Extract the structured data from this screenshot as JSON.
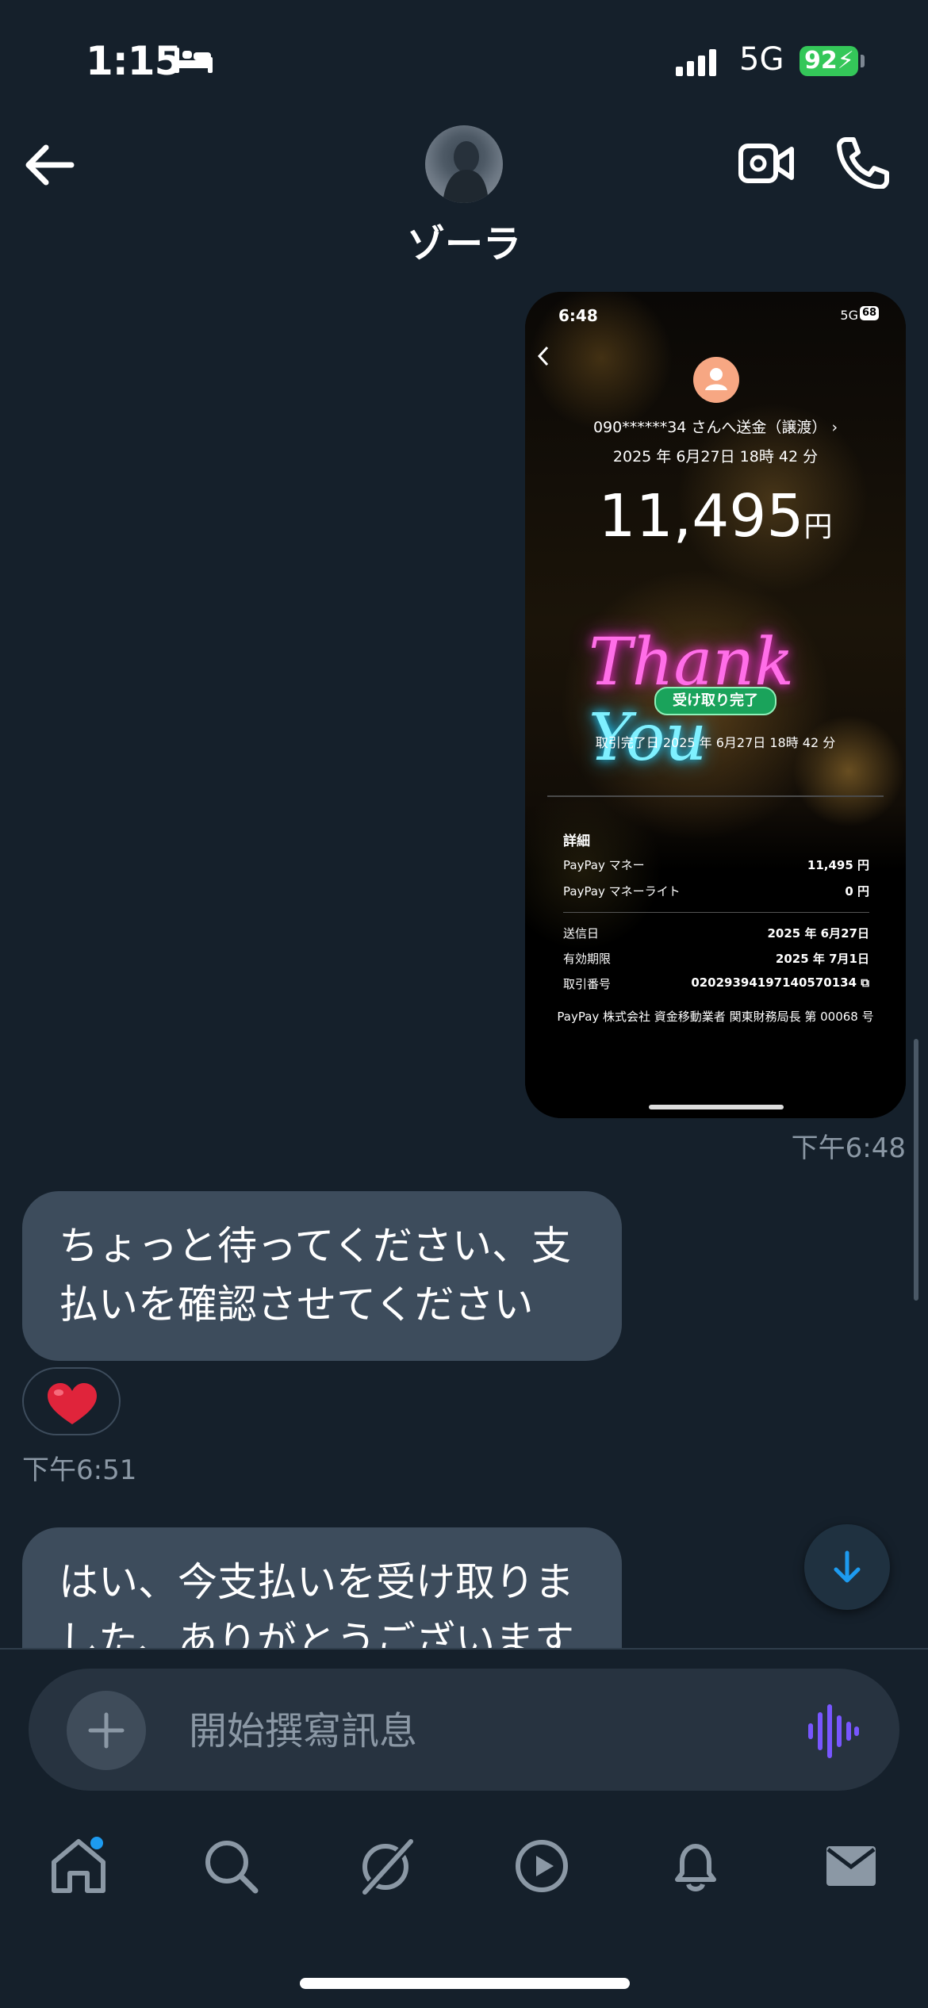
{
  "status_bar": {
    "time": "1:15",
    "network": "5G",
    "battery": "92"
  },
  "header": {
    "contact_name": "ゾーラ"
  },
  "image_message": {
    "status_time": "6:48",
    "status_network": "5G",
    "status_battery": "68",
    "recipient": "090******34 さんへ送金（譲渡）",
    "date": "2025 年 6月27日 18時 42 分",
    "amount": "11,495",
    "currency": "円",
    "thank": "Thank",
    "you": "You",
    "received_badge": "受け取り完了",
    "completed": "取引完了日 2025 年 6月27日 18時 42 分",
    "details_title": "詳細",
    "rows": [
      {
        "label": "PayPay マネー",
        "value": "11,495 円"
      },
      {
        "label": "PayPay マネーライト",
        "value": "0 円"
      },
      {
        "label": "送信日",
        "value": "2025 年 6月27日"
      },
      {
        "label": "有効期限",
        "value": "2025 年 7月1日"
      },
      {
        "label": "取引番号",
        "value": "02029394197140570134"
      }
    ],
    "footer": "PayPay 株式会社 資金移動業者 関東財務局長 第 00068 号"
  },
  "messages": [
    {
      "timestamp": "下午6:48"
    },
    {
      "text": "ちょっと待ってください、支払いを確認させてください",
      "reaction": "❤️",
      "timestamp": "下午6:51"
    },
    {
      "text": "はい、今支払いを受け取りました、ありがとうございます"
    }
  ],
  "composer": {
    "placeholder": "開始撰寫訊息"
  },
  "nav": [
    "home-icon",
    "search-icon",
    "grok-icon",
    "video-icon",
    "notifications-icon",
    "messages-icon"
  ],
  "colors": {
    "background": "#15202b",
    "bubble": "#3d4c5c",
    "accent": "#1d9bf0",
    "voice": "#7856ff",
    "badge_green": "#1aa35b"
  }
}
